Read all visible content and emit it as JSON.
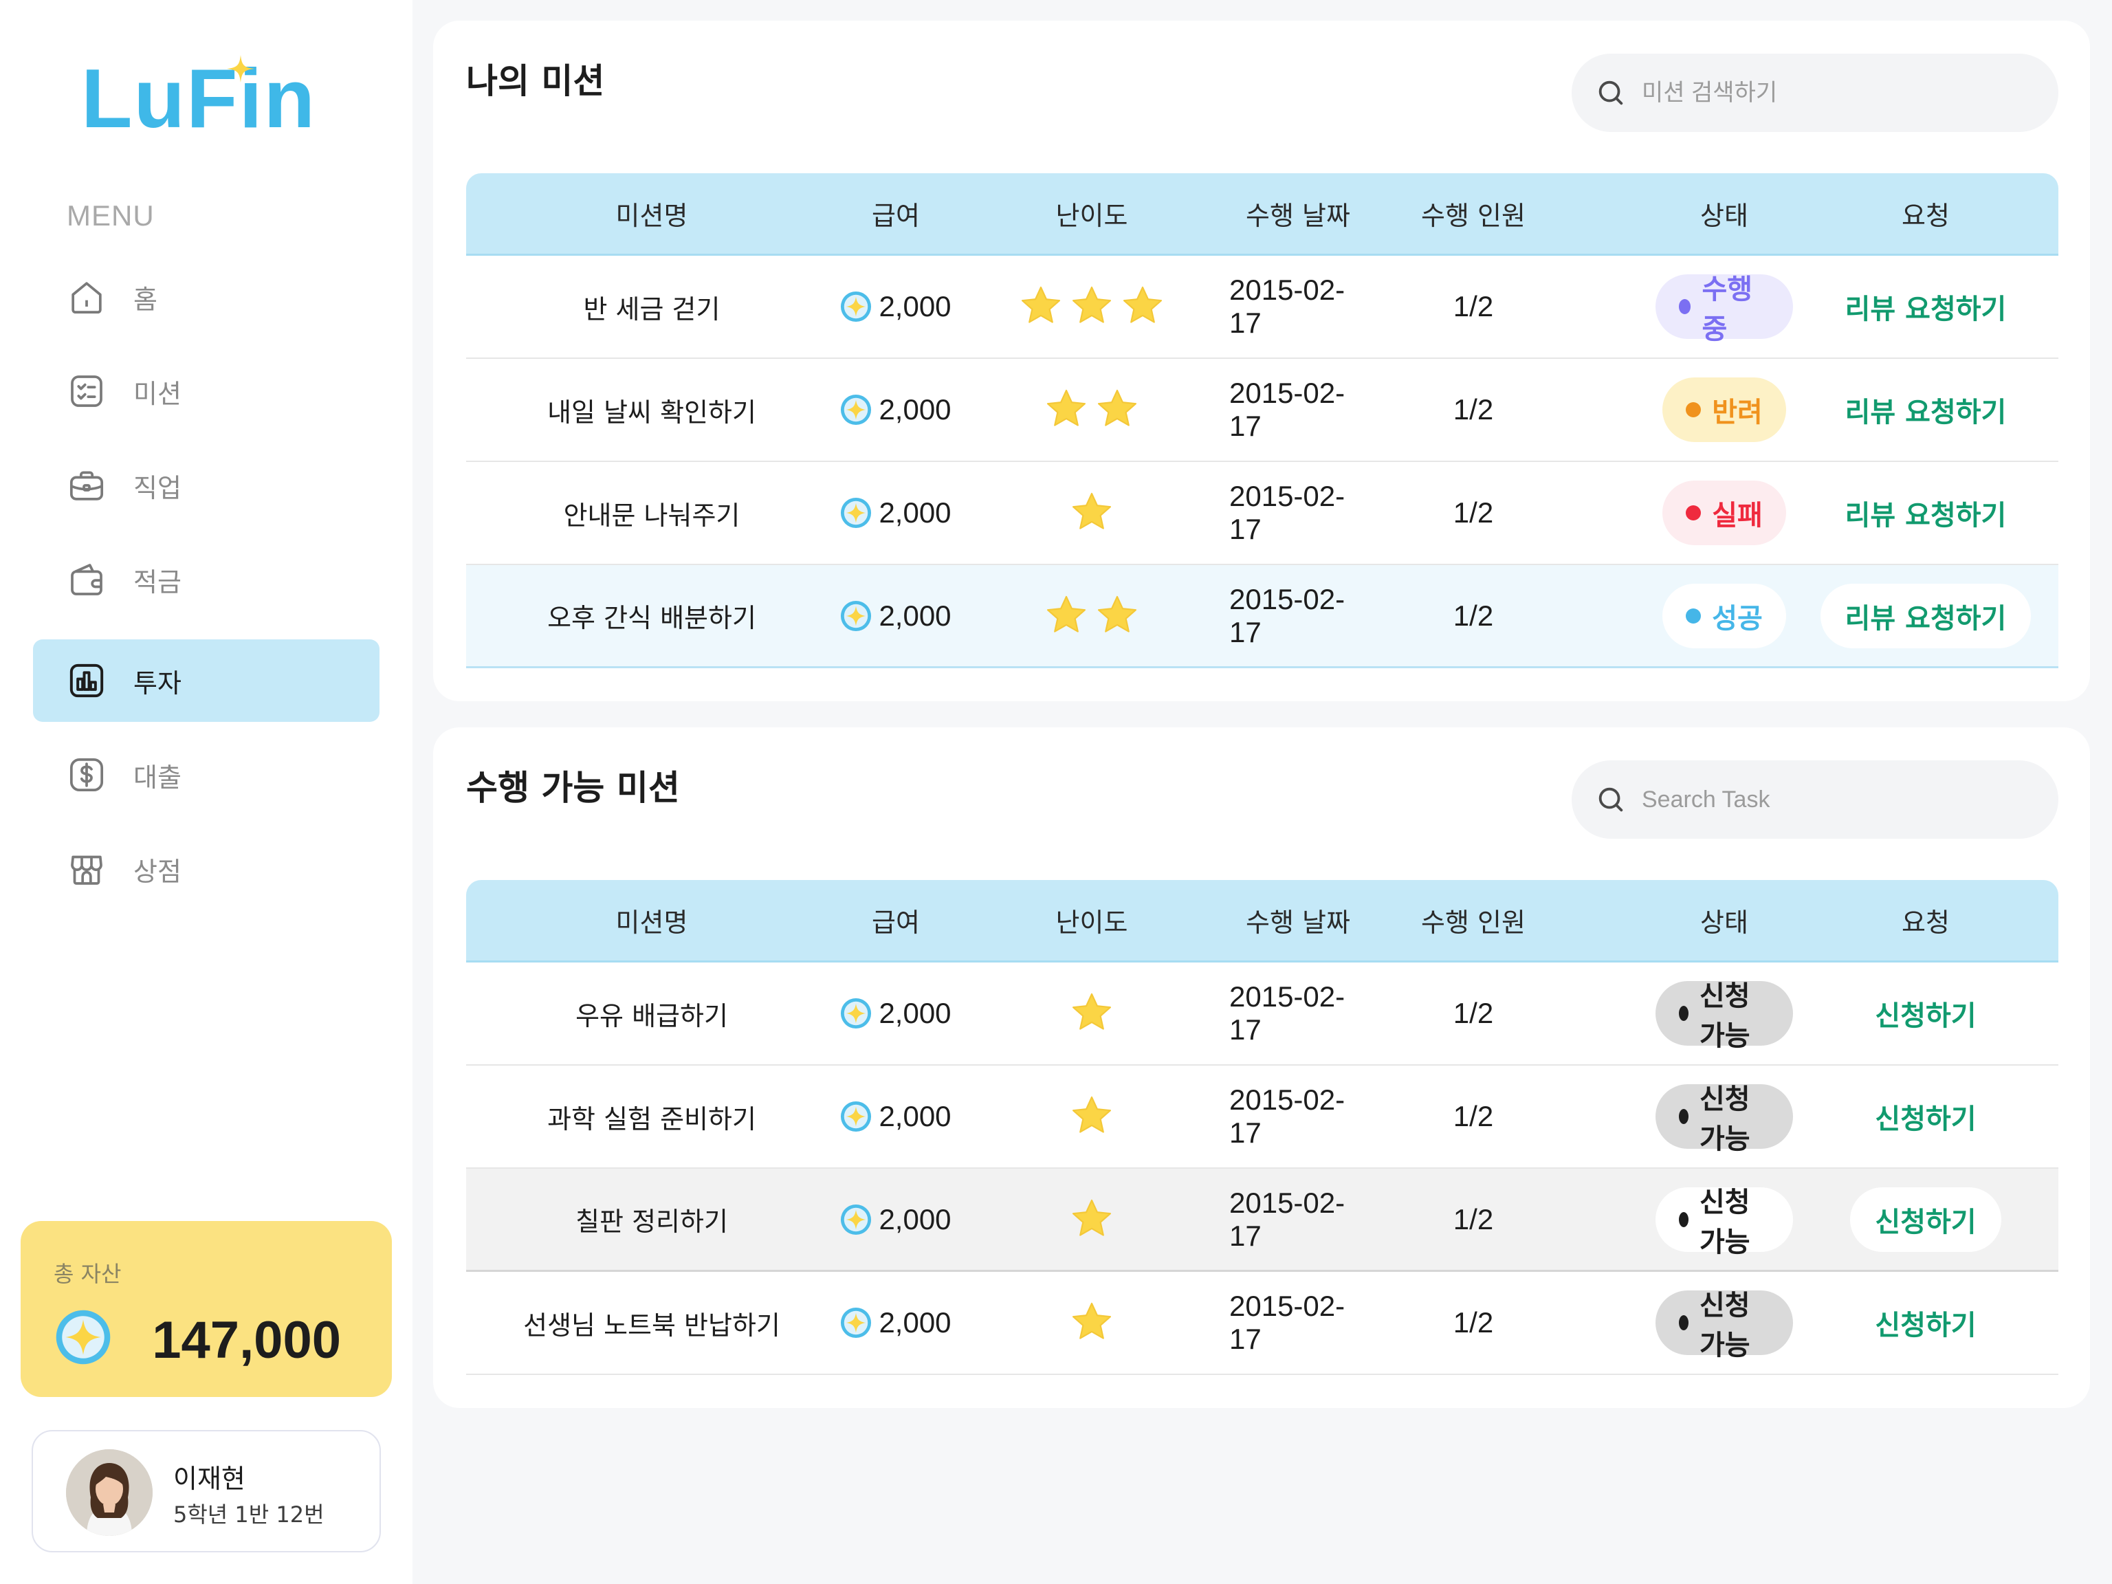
{
  "brand": {
    "logo_text": "LuFin"
  },
  "sidebar": {
    "menu_title": "MENU",
    "items": [
      {
        "label": "홈",
        "icon": "home-icon"
      },
      {
        "label": "미션",
        "icon": "checklist-icon"
      },
      {
        "label": "직업",
        "icon": "briefcase-icon"
      },
      {
        "label": "적금",
        "icon": "wallet-icon"
      },
      {
        "label": "투자",
        "icon": "chart-icon",
        "active": true
      },
      {
        "label": "대출",
        "icon": "dollar-icon"
      },
      {
        "label": "상점",
        "icon": "store-icon"
      }
    ],
    "asset": {
      "label": "총 자산",
      "value": "147,000"
    },
    "profile": {
      "name": "이재현",
      "class": "5학년 1반 12번"
    }
  },
  "my_missions": {
    "title": "나의 미션",
    "search_placeholder": "미션 검색하기",
    "columns": [
      "미션명",
      "급여",
      "난이도",
      "수행 날짜",
      "수행 인원",
      "상태",
      "요청"
    ],
    "rows": [
      {
        "name": "반 세금 걷기",
        "pay": "2,000",
        "difficulty": 3,
        "date": "2015-02-17",
        "people": "1/2",
        "status": "수행 중",
        "action": "리뷰 요청하기"
      },
      {
        "name": "내일 날씨 확인하기",
        "pay": "2,000",
        "difficulty": 2,
        "date": "2015-02-17",
        "people": "1/2",
        "status": "반려",
        "action": "리뷰 요청하기"
      },
      {
        "name": "안내문 나눠주기",
        "pay": "2,000",
        "difficulty": 1,
        "date": "2015-02-17",
        "people": "1/2",
        "status": "실패",
        "action": "리뷰 요청하기"
      },
      {
        "name": "오후 간식 배분하기",
        "pay": "2,000",
        "difficulty": 2,
        "date": "2015-02-17",
        "people": "1/2",
        "status": "성공",
        "action": "리뷰 요청하기"
      }
    ]
  },
  "available_missions": {
    "title": "수행 가능 미션",
    "search_placeholder": "Search Task",
    "columns": [
      "미션명",
      "급여",
      "난이도",
      "수행 날짜",
      "수행 인원",
      "상태",
      "요청"
    ],
    "rows": [
      {
        "name": "우유 배급하기",
        "pay": "2,000",
        "difficulty": 1,
        "date": "2015-02-17",
        "people": "1/2",
        "status": "신청 가능",
        "action": "신청하기"
      },
      {
        "name": "과학 실험 준비하기",
        "pay": "2,000",
        "difficulty": 1,
        "date": "2015-02-17",
        "people": "1/2",
        "status": "신청 가능",
        "action": "신청하기"
      },
      {
        "name": "칠판 정리하기",
        "pay": "2,000",
        "difficulty": 1,
        "date": "2015-02-17",
        "people": "1/2",
        "status": "신청 가능",
        "action": "신청하기"
      },
      {
        "name": "선생님 노트북 반납하기",
        "pay": "2,000",
        "difficulty": 1,
        "date": "2015-02-17",
        "people": "1/2",
        "status": "신청 가능",
        "action": "신청하기"
      }
    ]
  },
  "colors": {
    "accent": "#3fb8e8",
    "header_bg": "#c5e9f8",
    "asset_card": "#fbe281",
    "action_green": "#119a6e",
    "star": "#fbd545"
  }
}
